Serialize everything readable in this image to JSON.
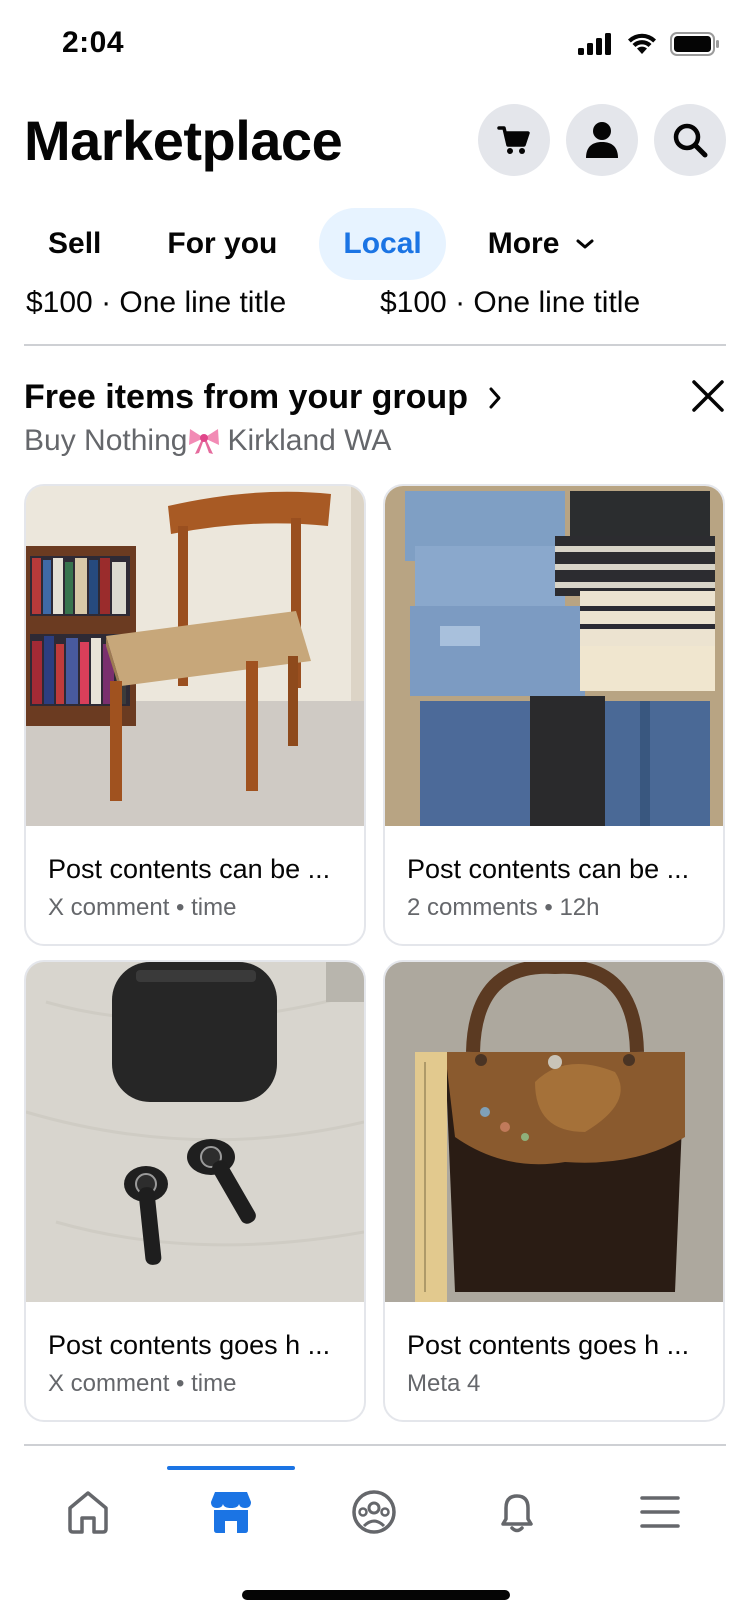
{
  "status_bar": {
    "time": "2:04"
  },
  "header": {
    "title": "Marketplace",
    "icons": {
      "cart": "shopping-cart-icon",
      "profile": "person-icon",
      "search": "search-icon"
    }
  },
  "tabs": [
    {
      "label": "Sell",
      "active": false
    },
    {
      "label": "For you",
      "active": false
    },
    {
      "label": "Local",
      "active": true
    },
    {
      "label": "More",
      "active": false
    }
  ],
  "cutoff_row": {
    "left": "$100 · One line title",
    "right": "$100 · One line title"
  },
  "section": {
    "title": "Free items from your group",
    "subtitle_prefix": "Buy Nothing",
    "subtitle_suffix": "Kirkland WA"
  },
  "cards": [
    {
      "title": "Post contents can be ...",
      "meta": "X comment • time",
      "image": "wooden-chair-photo"
    },
    {
      "title": "Post contents can be ...",
      "meta": "2 comments • 12h",
      "image": "folded-clothes-photo"
    },
    {
      "title": "Post contents goes h ...",
      "meta": "X comment • time",
      "image": "earbuds-photo"
    },
    {
      "title": "Post contents goes h ...",
      "meta": "Meta 4",
      "image": "leather-bag-photo"
    }
  ],
  "bottom_nav": [
    {
      "name": "home-icon",
      "active": false
    },
    {
      "name": "marketplace-icon",
      "active": true
    },
    {
      "name": "groups-icon",
      "active": false
    },
    {
      "name": "bell-icon",
      "active": false
    },
    {
      "name": "menu-icon",
      "active": false
    }
  ],
  "colors": {
    "accent": "#1b74e4",
    "accent_bg": "#e7f3ff",
    "secondary_text": "#65676b",
    "button_bg": "#e4e6eb"
  }
}
